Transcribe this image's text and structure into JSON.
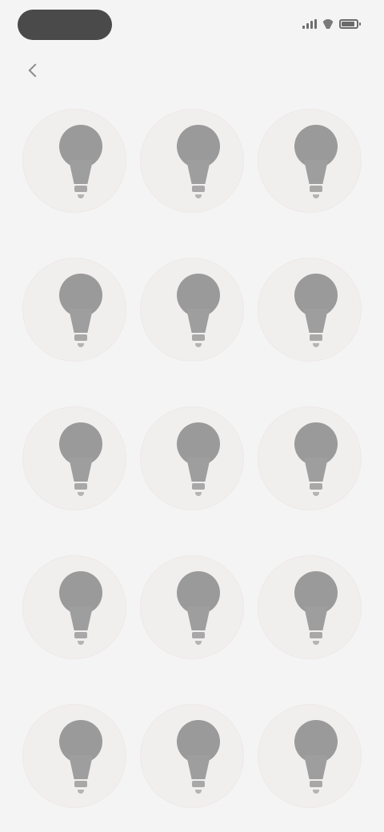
{
  "status_bar": {
    "header_pill_label": "",
    "time": "",
    "icons": [
      "signal-icon",
      "wifi-icon",
      "battery-icon"
    ]
  },
  "header": {
    "back_icon": "chevron-left-icon",
    "back_label": ""
  },
  "grid": {
    "tile_icon": "light-bulb-icon",
    "tiles": [
      {
        "label": ""
      },
      {
        "label": ""
      },
      {
        "label": ""
      },
      {
        "label": ""
      },
      {
        "label": ""
      },
      {
        "label": ""
      },
      {
        "label": ""
      },
      {
        "label": ""
      },
      {
        "label": ""
      },
      {
        "label": ""
      },
      {
        "label": ""
      },
      {
        "label": ""
      },
      {
        "label": ""
      },
      {
        "label": ""
      },
      {
        "label": ""
      }
    ]
  },
  "colors": {
    "background": "#f4f4f4",
    "pill": "#4a4a4a",
    "tile_circle": "#f1eeee",
    "icon": "#9a9a9a",
    "label": "#7c7c7c"
  }
}
